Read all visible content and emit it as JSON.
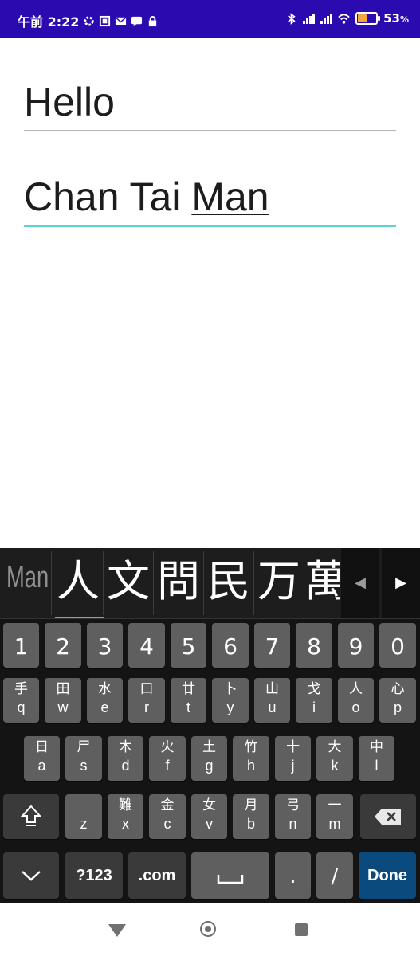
{
  "status_bar": {
    "time": "午前 2:22",
    "battery": "53",
    "battery_suffix": "%",
    "battery_level": 0.53
  },
  "fields": [
    {
      "text": "Hello"
    },
    {
      "text_plain": "Chan Tai ",
      "text_composing": "Man"
    }
  ],
  "ime": {
    "composing": "Man",
    "candidates": [
      "人",
      "文",
      "問",
      "民",
      "万",
      "萬"
    ],
    "prev_icon": "caret-left-icon",
    "next_icon": "caret-right-icon"
  },
  "keyboard": {
    "number_row": [
      "1",
      "2",
      "3",
      "4",
      "5",
      "6",
      "7",
      "8",
      "9",
      "0"
    ],
    "row1": [
      {
        "radical": "手",
        "latin": "q"
      },
      {
        "radical": "田",
        "latin": "w"
      },
      {
        "radical": "水",
        "latin": "e"
      },
      {
        "radical": "口",
        "latin": "r"
      },
      {
        "radical": "廿",
        "latin": "t"
      },
      {
        "radical": "卜",
        "latin": "y"
      },
      {
        "radical": "山",
        "latin": "u"
      },
      {
        "radical": "戈",
        "latin": "i"
      },
      {
        "radical": "人",
        "latin": "o"
      },
      {
        "radical": "心",
        "latin": "p"
      }
    ],
    "row2": [
      {
        "radical": "日",
        "latin": "a"
      },
      {
        "radical": "尸",
        "latin": "s"
      },
      {
        "radical": "木",
        "latin": "d"
      },
      {
        "radical": "火",
        "latin": "f"
      },
      {
        "radical": "土",
        "latin": "g"
      },
      {
        "radical": "竹",
        "latin": "h"
      },
      {
        "radical": "十",
        "latin": "j"
      },
      {
        "radical": "大",
        "latin": "k"
      },
      {
        "radical": "中",
        "latin": "l"
      }
    ],
    "row3": [
      {
        "radical": "",
        "latin": "z"
      },
      {
        "radical": "難",
        "latin": "x"
      },
      {
        "radical": "金",
        "latin": "c"
      },
      {
        "radical": "女",
        "latin": "v"
      },
      {
        "radical": "月",
        "latin": "b"
      },
      {
        "radical": "弓",
        "latin": "n"
      },
      {
        "radical": "一",
        "latin": "m"
      }
    ],
    "shift_icon": "shift-icon",
    "backspace_icon": "backspace-icon",
    "hide_icon": "chevron-down-icon",
    "symbols_label": "?123",
    "dotcom_label": ".com",
    "space_icon": "space-bar-icon",
    "period_label": ".",
    "slash_label": "/",
    "done_label": "Done"
  },
  "nav_bar": {
    "back_icon": "back-triangle-icon",
    "home_icon": "home-circle-icon",
    "recents_icon": "recents-square-icon"
  }
}
